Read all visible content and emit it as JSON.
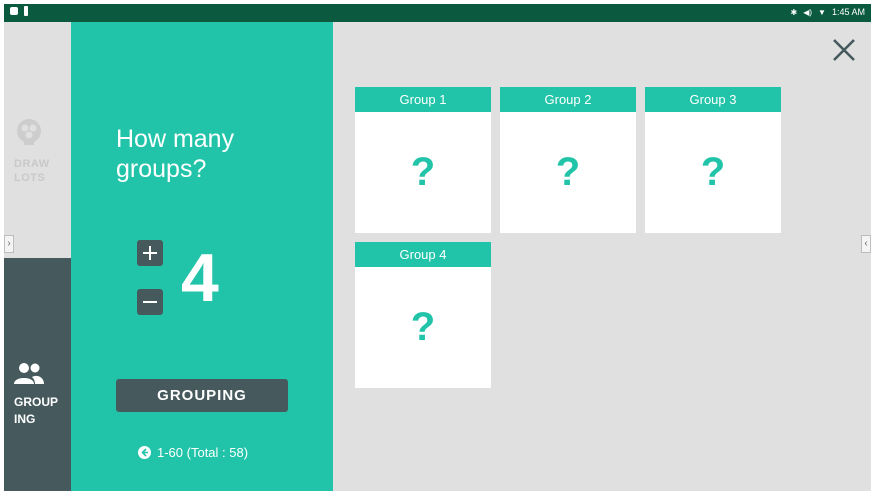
{
  "status_bar": {
    "time": "1:45 AM"
  },
  "modes": {
    "draw_lots": {
      "label": "DRAW\nLOTS",
      "icon": "lottery-ball-icon"
    },
    "grouping": {
      "label": "GROUP\nING",
      "icon": "people-icon"
    }
  },
  "panel": {
    "question": "How many groups?",
    "count": "4",
    "grouping_button": "GROUPING",
    "range_text": "1-60 (Total : 58)"
  },
  "groups": [
    {
      "name": "Group 1",
      "mark": "?"
    },
    {
      "name": "Group 2",
      "mark": "?"
    },
    {
      "name": "Group 3",
      "mark": "?"
    },
    {
      "name": "Group 4",
      "mark": "?"
    }
  ],
  "colors": {
    "accent": "#21c4a8",
    "dark": "#465a5e",
    "background": "#e0e0e0",
    "status_bar": "#0b5a3f"
  }
}
